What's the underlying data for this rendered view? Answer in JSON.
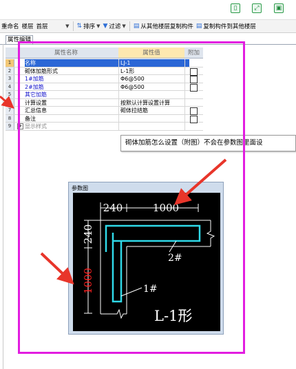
{
  "window_icons": [
    "tablet-icon",
    "expand-icon",
    "save-icon"
  ],
  "toolbar": {
    "rename": "重命名",
    "floor_label": "楼层",
    "floor_value": "首层",
    "sort": "排序",
    "filter": "过滤",
    "copy_from": "从其他楼层复制构件",
    "copy_to": "复制构件到其他楼层"
  },
  "tab": {
    "label": "属性编辑"
  },
  "grid": {
    "headers": {
      "name": "属性名称",
      "value": "属性值",
      "attach": "附加"
    },
    "rows": [
      {
        "num": "1",
        "name": "名称",
        "value": "LJ-1",
        "checkbox": false,
        "selected": true,
        "blue": true
      },
      {
        "num": "2",
        "name": "砌体加筋形式",
        "value": "L-1形",
        "checkbox": true,
        "selected": false,
        "blue": false
      },
      {
        "num": "3",
        "name": "1#加筋",
        "value": "Φ6@500",
        "checkbox": true,
        "selected": false,
        "blue": true
      },
      {
        "num": "4",
        "name": "2#加筋",
        "value": "Φ6@500",
        "checkbox": true,
        "selected": false,
        "blue": true
      },
      {
        "num": "5",
        "name": "其它加筋",
        "value": "",
        "checkbox": false,
        "selected": false,
        "blue": true
      },
      {
        "num": "6",
        "name": "计算设置",
        "value": "按默认计算设置计算",
        "checkbox": false,
        "selected": false,
        "blue": false
      },
      {
        "num": "7",
        "name": "汇总信息",
        "value": "砌体拉结筋",
        "checkbox": true,
        "selected": false,
        "blue": false
      },
      {
        "num": "8",
        "name": "备注",
        "value": "",
        "checkbox": true,
        "selected": false,
        "blue": false
      },
      {
        "num": "9",
        "name": "显示样式",
        "value": "",
        "checkbox": false,
        "selected": false,
        "blue": false,
        "expandable": true
      }
    ]
  },
  "tooltip": {
    "text": "砌体加筋怎么设置（附图）不会在参数图里面设"
  },
  "params_window": {
    "title": "参数图",
    "dim_top_left": "240",
    "dim_top_right": "1000",
    "dim_left_top": "240",
    "dim_left_bottom": "1000",
    "bar2_label": "2#",
    "bar1_label": "1#",
    "shape_label": "L-1形"
  },
  "colors": {
    "frame": "#e21de0",
    "arrow": "#e8352a",
    "rebar": "#2fd9e8",
    "dim_red": "#ff2020",
    "selected": "#2b67d6"
  }
}
